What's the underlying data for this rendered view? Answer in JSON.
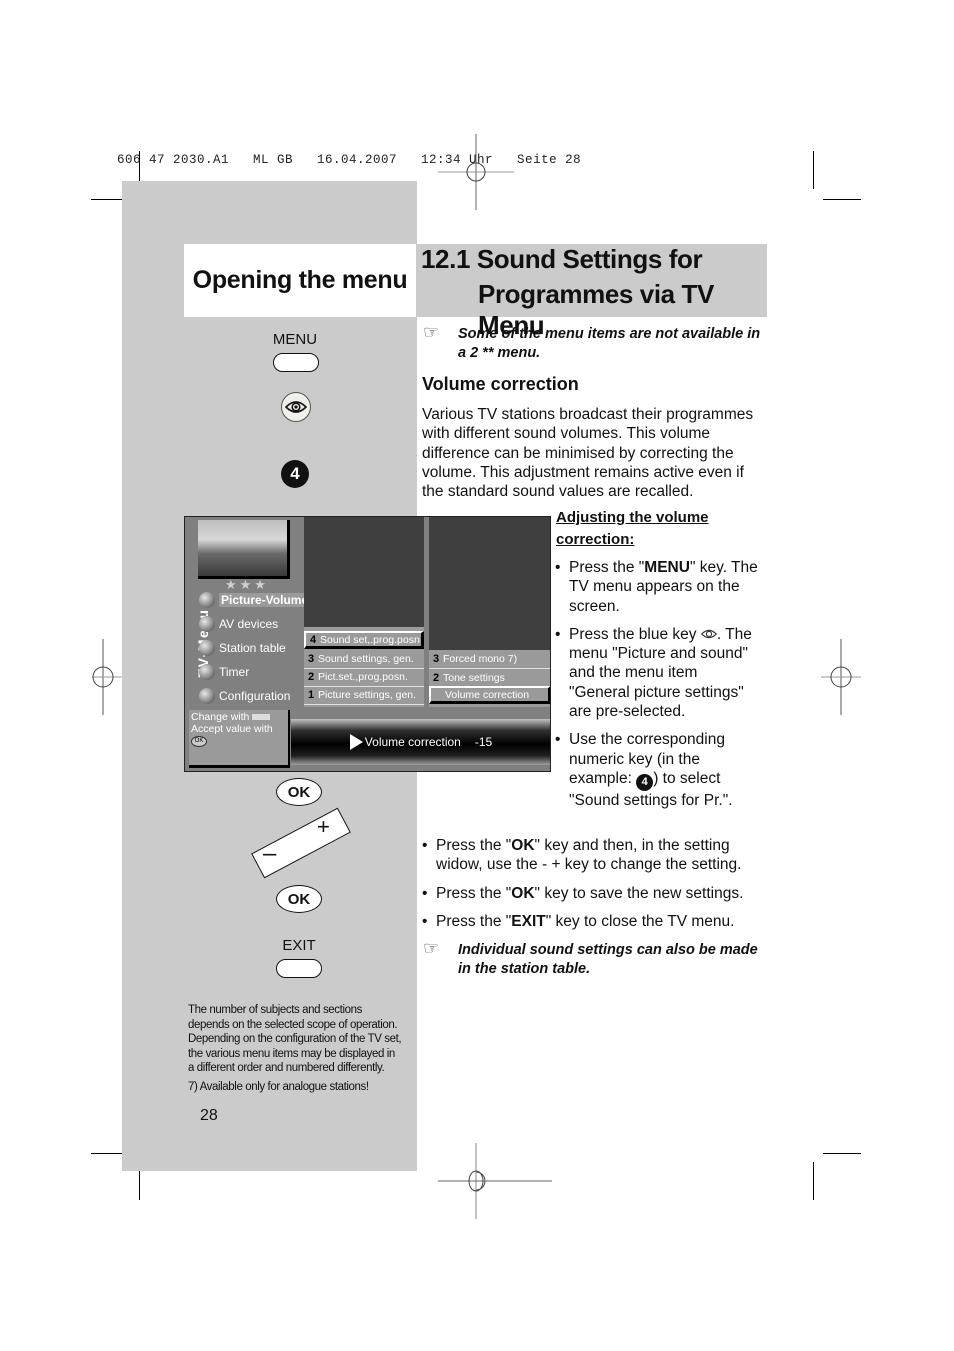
{
  "print_slug": "606 47 2030.A1   ML GB   16.04.2007   12:34 Uhr   Seite 28",
  "left_column": {
    "title": "Opening the menu",
    "keys": {
      "menu_label": "MENU",
      "blue_key_icon": "eye-icon",
      "numeric_key": "4",
      "ok_label_1": "OK",
      "minus_label": "–",
      "plus_label": "+",
      "ok_label_2": "OK",
      "exit_label": "EXIT"
    },
    "footnote_general": "The number of subjects and sections depends on the selected scope of operation. Depending on the configuration of the TV set, the various menu items may be displayed in a different order and numbered differently.",
    "footnote_7": "7) Available only for analogue stations!",
    "page_number": "28"
  },
  "right_column": {
    "title_line1": "12.1 Sound Settings for",
    "title_line2": "Programmes via TV Menu",
    "note_top": "Some of the menu items are not available in a 2 ** menu.",
    "section_heading": "Volume correction",
    "intro": "Various TV stations broadcast their programmes with different sound volumes. This volume difference can be minimised by correcting the volume. This adjustment remains active even if the standard sound values are recalled.",
    "adjust_heading": "Adjusting the volume correction:",
    "steps_side": [
      {
        "pre": "Press the \"",
        "bold": "MENU",
        "post": "\" key. The TV menu appears on the screen."
      },
      {
        "pre": "Press the blue key ",
        "icon": "eye-icon",
        "post": ". The menu \"Picture and sound\" and the menu item \"General picture settings\" are pre-selected."
      },
      {
        "pre": "Use the corresponding numeric key (in the example: ",
        "icon": "4",
        "post": ") to select \"Sound settings for Pr.\"."
      }
    ],
    "steps_full": [
      {
        "pre": "Press the \"",
        "bold": "OK",
        "post": "\" key and then, in the setting widow, use the - + key to change the setting."
      },
      {
        "pre": "Press the \"",
        "bold": "OK",
        "post": "\" key to save the new settings."
      },
      {
        "pre": "Press the \"",
        "bold": "EXIT",
        "post": "\" key to close the TV menu."
      }
    ],
    "note_bottom": "Individual sound settings can also be made in the station table."
  },
  "tv_menu": {
    "vertical_label": "TV-Menu",
    "stars": "★★★",
    "main_items": [
      {
        "label": "Picture-Volume",
        "selected": true
      },
      {
        "label": "AV devices",
        "selected": false
      },
      {
        "label": "Station table",
        "selected": false
      },
      {
        "label": "Timer",
        "selected": false
      },
      {
        "label": "Configuration",
        "selected": false
      }
    ],
    "sub_items": [
      {
        "num": "4",
        "label": "Sound set,.prog.posn",
        "selected": true
      },
      {
        "num": "3",
        "label": "Sound settings, gen.",
        "selected": false
      },
      {
        "num": "2",
        "label": "Pict.set.,prog.posn.",
        "selected": false
      },
      {
        "num": "1",
        "label": "Picture settings, gen.",
        "selected": false
      }
    ],
    "sub_sub_items": [
      {
        "num": "3",
        "label": "Forced mono 7)",
        "selected": false
      },
      {
        "num": "2",
        "label": "Tone settings",
        "selected": false
      },
      {
        "num": "1",
        "label": "Volume correction",
        "selected": true
      }
    ],
    "hint_change": "Change with",
    "hint_accept": "Accept value with",
    "value_label": "Volume correction",
    "value": "-15"
  }
}
